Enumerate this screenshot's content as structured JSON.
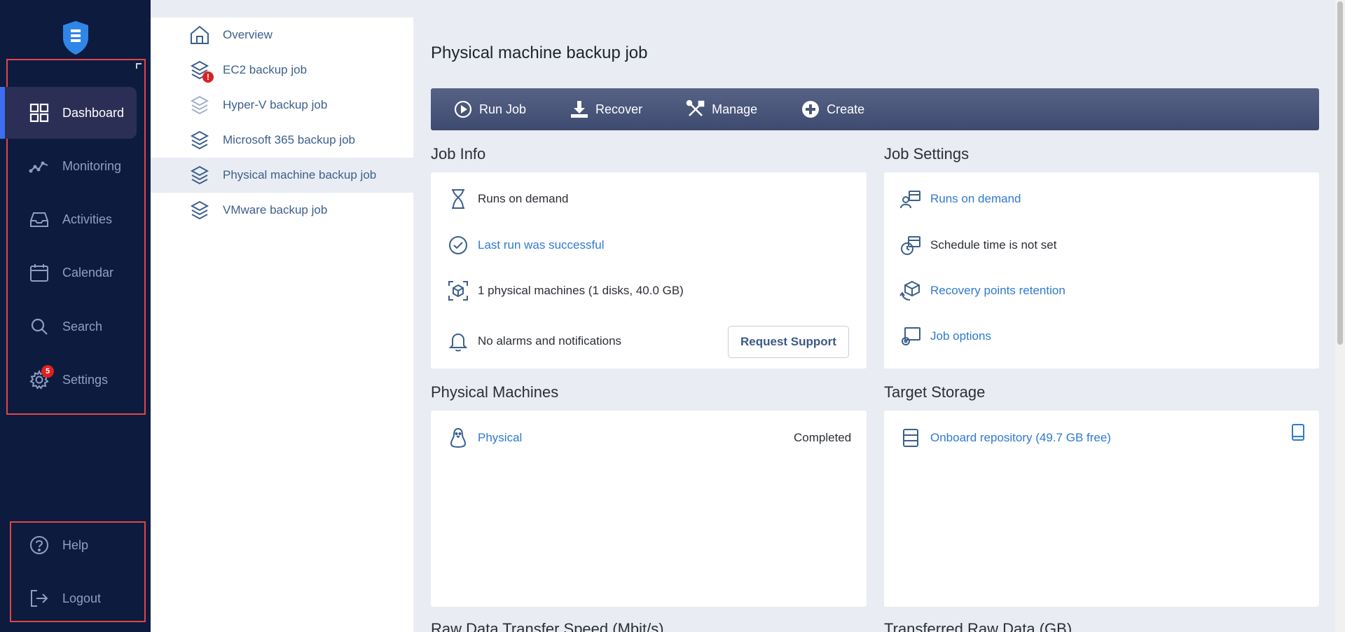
{
  "nav": {
    "items": [
      {
        "label": "Dashboard",
        "icon": "dashboard-grid-icon"
      },
      {
        "label": "Monitoring",
        "icon": "monitoring-line-icon"
      },
      {
        "label": "Activities",
        "icon": "inbox-tray-icon"
      },
      {
        "label": "Calendar",
        "icon": "calendar-icon"
      },
      {
        "label": "Search",
        "icon": "search-icon"
      },
      {
        "label": "Settings",
        "icon": "gear-icon",
        "badge": "5"
      }
    ],
    "bottom": [
      {
        "label": "Help",
        "icon": "help-circle-icon"
      },
      {
        "label": "Logout",
        "icon": "logout-icon"
      }
    ],
    "accent": "#3d6ef0",
    "highlight_border": "#e0454a"
  },
  "tree": {
    "items": [
      {
        "label": "Overview"
      },
      {
        "label": "EC2 backup job",
        "error": "!"
      },
      {
        "label": "Hyper-V backup job"
      },
      {
        "label": "Microsoft 365 backup job"
      },
      {
        "label": "Physical machine backup job",
        "selected": true
      },
      {
        "label": "VMware backup job"
      }
    ]
  },
  "main": {
    "title": "Physical machine backup job",
    "toolbar": {
      "run_job": "Run Job",
      "recover": "Recover",
      "manage": "Manage",
      "create": "Create"
    },
    "job_info": {
      "title": "Job Info",
      "runs": "Runs on demand",
      "last_run": "Last run was successful",
      "machines": "1 physical machines (1 disks, 40.0 GB)",
      "alarms": "No alarms and notifications",
      "request_support": "Request Support"
    },
    "job_settings": {
      "title": "Job Settings",
      "runs": "Runs on demand",
      "schedule": "Schedule time is not set",
      "retention": "Recovery points retention",
      "options": "Job options"
    },
    "physical_machines": {
      "title": "Physical Machines",
      "name": "Physical",
      "status": "Completed"
    },
    "target_storage": {
      "title": "Target Storage",
      "repository": "Onboard repository (49.7 GB free)"
    },
    "raw_speed_title": "Raw Data Transfer Speed (Mbit/s)",
    "transferred_title": "Transferred Raw Data (GB)"
  }
}
